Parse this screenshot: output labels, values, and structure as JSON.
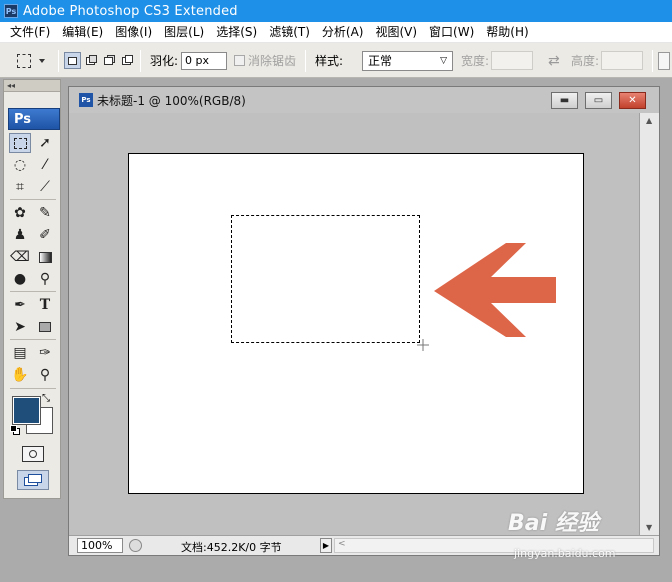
{
  "app": {
    "title": "Adobe Photoshop CS3 Extended",
    "logo_text": "Ps"
  },
  "menu": {
    "items": [
      "文件(F)",
      "编辑(E)",
      "图像(I)",
      "图层(L)",
      "选择(S)",
      "滤镜(T)",
      "分析(A)",
      "视图(V)",
      "窗口(W)",
      "帮助(H)"
    ]
  },
  "options": {
    "feather_label": "羽化:",
    "feather_value": "0 px",
    "antialias_label": "消除锯齿",
    "style_label": "样式:",
    "style_value": "正常",
    "width_label": "宽度:",
    "height_label": "高度:"
  },
  "toolbox": {
    "badge": "Ps",
    "foreground_color": "#1f4e7a",
    "background_color": "#ffffff"
  },
  "document": {
    "title": "未标题-1 @ 100%(RGB/8)",
    "zoom": "100%",
    "doc_info": "文档:452.2K/0 字节"
  },
  "annotation": {
    "arrow_color": "#dd6548"
  },
  "watermark": {
    "logo": "Bai 经验",
    "url": "jingyan.baidu.com"
  }
}
